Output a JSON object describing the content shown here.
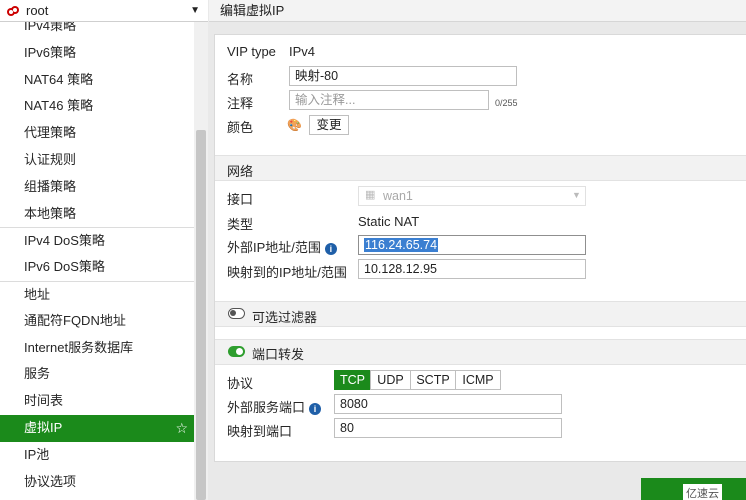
{
  "vdom": {
    "label": "root"
  },
  "sidebar": {
    "items": [
      {
        "label": "IPv4策略",
        "sep": false,
        "active": false
      },
      {
        "label": "IPv6策略",
        "sep": false,
        "active": false
      },
      {
        "label": "NAT64 策略",
        "sep": false,
        "active": false
      },
      {
        "label": "NAT46 策略",
        "sep": false,
        "active": false
      },
      {
        "label": "代理策略",
        "sep": false,
        "active": false
      },
      {
        "label": "认证规则",
        "sep": false,
        "active": false
      },
      {
        "label": "组播策略",
        "sep": false,
        "active": false
      },
      {
        "label": "本地策略",
        "sep": false,
        "active": false
      },
      {
        "label": "IPv4 DoS策略",
        "sep": true,
        "active": false
      },
      {
        "label": "IPv6 DoS策略",
        "sep": false,
        "active": false
      },
      {
        "label": "地址",
        "sep": true,
        "active": false
      },
      {
        "label": "通配符FQDN地址",
        "sep": false,
        "active": false
      },
      {
        "label": "Internet服务数据库",
        "sep": false,
        "active": false
      },
      {
        "label": "服务",
        "sep": false,
        "active": false
      },
      {
        "label": "时间表",
        "sep": false,
        "active": false
      },
      {
        "label": "虚拟IP",
        "sep": false,
        "active": true
      },
      {
        "label": "IP池",
        "sep": false,
        "active": false
      },
      {
        "label": "协议选项",
        "sep": false,
        "active": false
      }
    ]
  },
  "header": {
    "title": "编辑虚拟IP"
  },
  "form": {
    "vip_type_label": "VIP type",
    "vip_type_value": "IPv4",
    "name_label": "名称",
    "name_value": "映射-80",
    "comment_label": "注释",
    "comment_placeholder": "输入注释...",
    "comment_count": "0/255",
    "color_label": "颜色",
    "color_button": "变更"
  },
  "network": {
    "title": "网络",
    "interface_label": "接口",
    "interface_value": "wan1",
    "type_label": "类型",
    "type_value": "Static NAT",
    "ext_ip_label": "外部IP地址/范围",
    "ext_ip_value": "116.24.65.74",
    "mapped_ip_label": "映射到的IP地址/范围",
    "mapped_ip_value": "10.128.12.95"
  },
  "filter": {
    "title": "可选过滤器",
    "enabled": false
  },
  "port_forward": {
    "title": "端口转发",
    "enabled": true,
    "protocol_label": "协议",
    "protocols": [
      "TCP",
      "UDP",
      "SCTP",
      "ICMP"
    ],
    "selected_protocol": "TCP",
    "ext_port_label": "外部服务端口",
    "ext_port_value": "8080",
    "map_port_label": "映射到端口",
    "map_port_value": "80"
  },
  "watermark": "亿速云",
  "colors": {
    "accent": "#1b8a1b",
    "selection": "#3b7fd1",
    "info": "#1f5fa8"
  }
}
